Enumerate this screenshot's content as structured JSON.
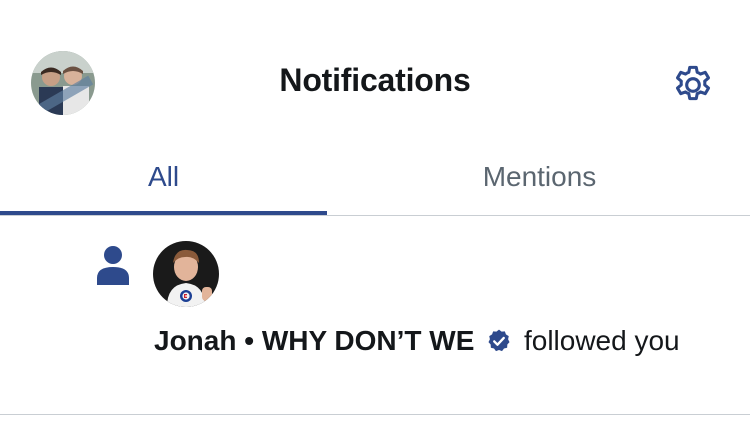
{
  "header": {
    "title": "Notifications",
    "avatar_icon": "profile-avatar",
    "settings_icon": "gear-icon"
  },
  "tabs": [
    {
      "label": "All",
      "active": true
    },
    {
      "label": "Mentions",
      "active": false
    }
  ],
  "notifications": [
    {
      "type_icon": "person-icon",
      "avatar_icon": "user-avatar",
      "actor_name": "Jonah • WHY DON’T WE",
      "verified": true,
      "action_text": "followed you"
    }
  ],
  "colors": {
    "accent": "#2e4a8c",
    "text_primary": "#14171a",
    "text_secondary": "#5b6670",
    "divider": "#c9ced3",
    "verified_badge": "#2e4a8c"
  }
}
